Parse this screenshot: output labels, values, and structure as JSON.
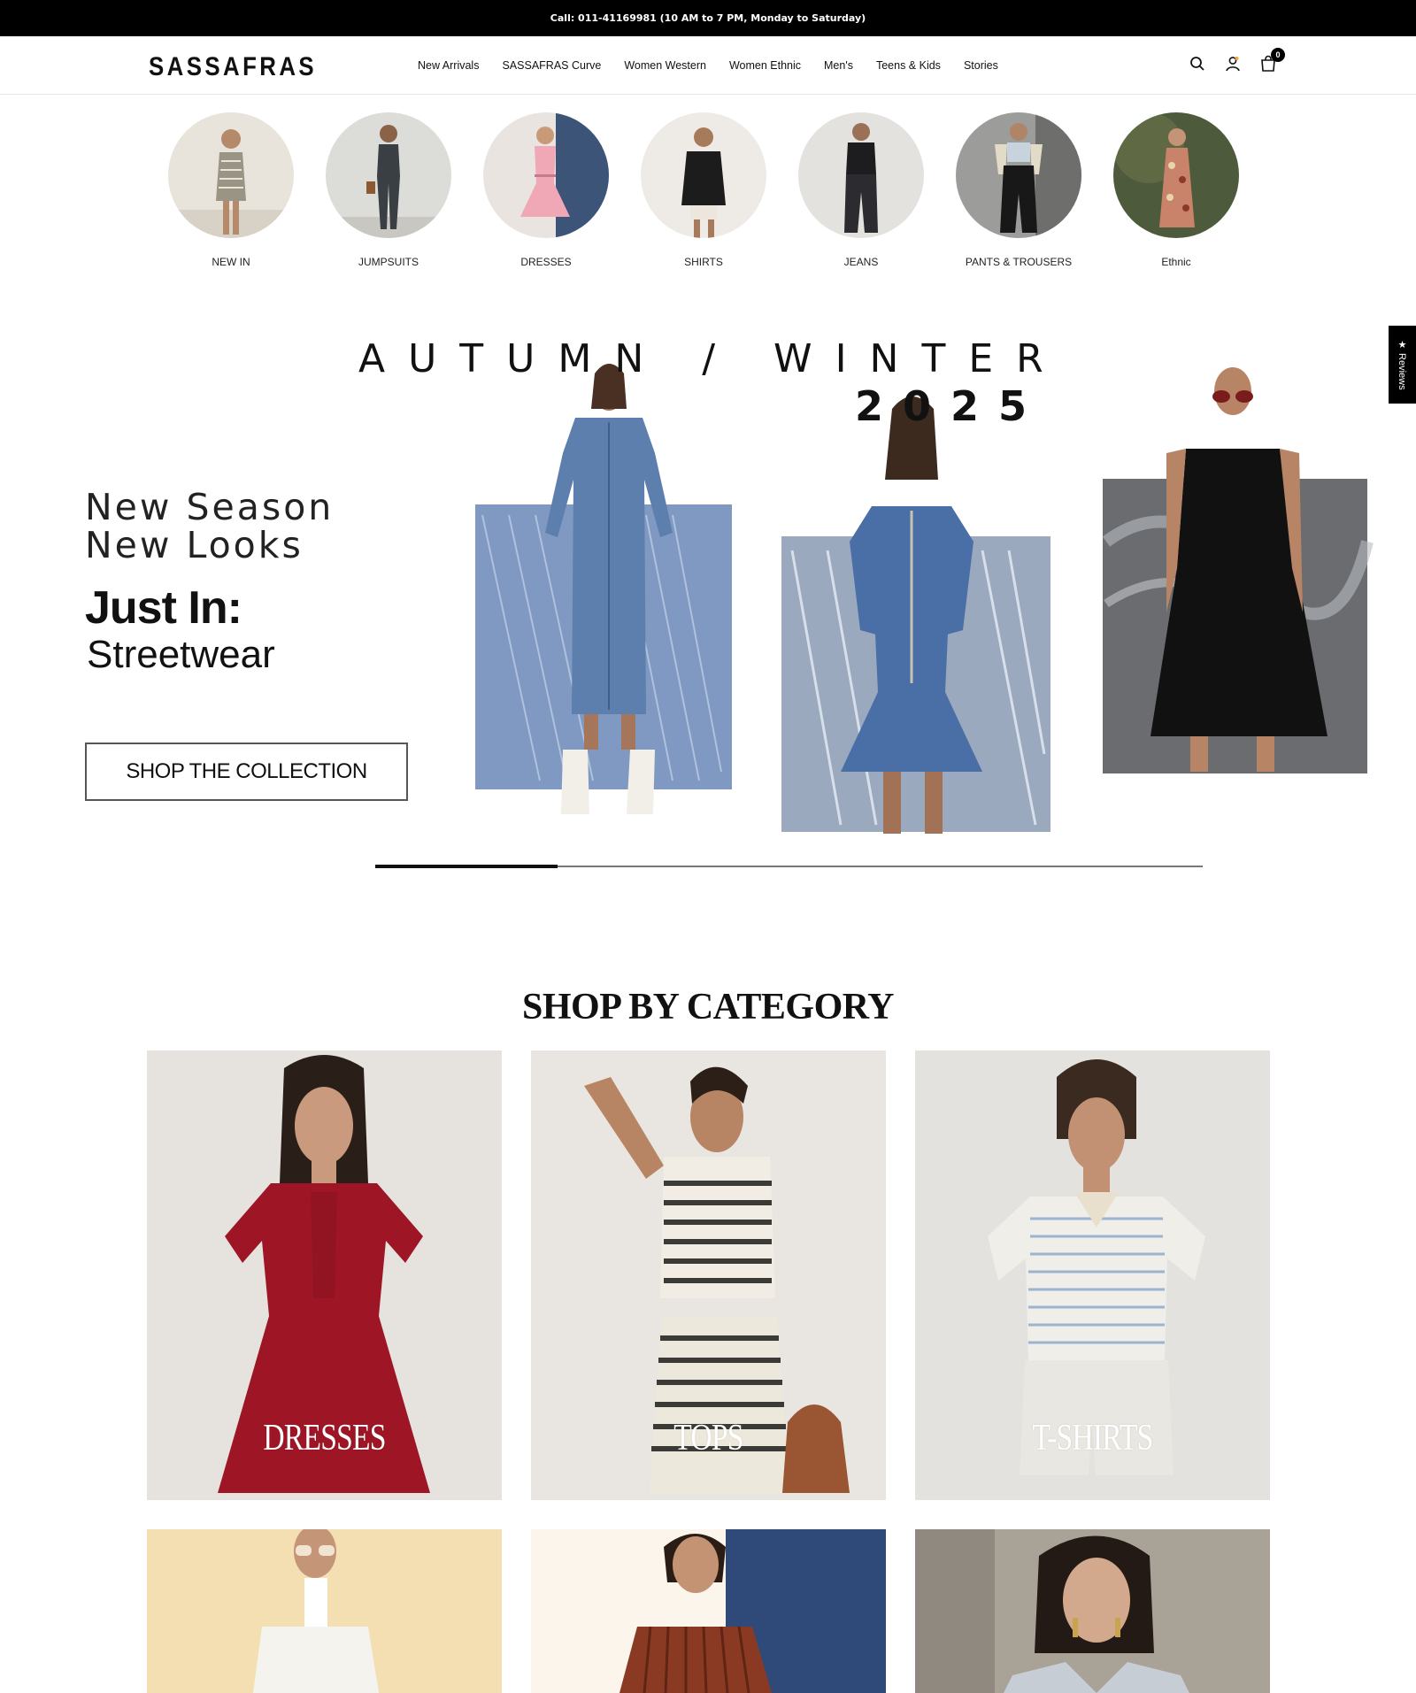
{
  "announcement": "Call: 011-41169981 (10 AM to 7 PM, Monday to Saturday)",
  "header": {
    "logo": "SASSAFRAS",
    "nav": [
      "New Arrivals",
      "SASSAFRAS Curve",
      "Women Western",
      "Women Ethnic",
      "Men's",
      "Teens & Kids",
      "Stories"
    ],
    "icons": [
      "search-icon",
      "account-icon",
      "cart-icon"
    ],
    "cart_count": "0"
  },
  "categories": [
    {
      "label": "NEW IN",
      "bg": "#e8e4dc",
      "outfit": "#9a9484"
    },
    {
      "label": "JUMPSUITS",
      "bg": "#dcdcd8",
      "outfit": "#3a3f44"
    },
    {
      "label": "DRESSES",
      "bg": "#e9e4df",
      "outfit": "#f0a7b6"
    },
    {
      "label": "SHIRTS",
      "bg": "#eeebe7",
      "outfit": "#1c1c1c"
    },
    {
      "label": "JEANS",
      "bg": "#e4e2de",
      "outfit": "#232326"
    },
    {
      "label": "PANTS & TROUSERS",
      "bg": "#9c9c9a",
      "outfit": "#181818"
    },
    {
      "label": "Ethnic",
      "bg": "#4e5a3c",
      "outfit": "#c8836a"
    }
  ],
  "hero": {
    "title": "AUTUMN / WINTER",
    "year": "2025",
    "line1": "New Season",
    "line2": "New Looks",
    "just_in": "Just In:",
    "subtitle": "Streetwear",
    "button": "SHOP THE COLLECTION",
    "slider_progress": 0.22
  },
  "reviews_tab": "★ Reviews",
  "shop_by_category": {
    "title": "SHOP BY CATEGORY",
    "cards": [
      {
        "label": "DRESSES",
        "bg": "#e6e3df",
        "outfit": "#9e1626"
      },
      {
        "label": "TOPS",
        "bg": "#e9e6e1",
        "outfit": "#3b3a36"
      },
      {
        "label": "T-SHIRTS",
        "bg": "#e4e2de",
        "outfit": "#e9e7e1"
      },
      {
        "label": "",
        "bg": "#f3dfb2",
        "outfit": "#f5f3ee"
      },
      {
        "label": "",
        "bg": "#fbf5ec",
        "outfit": "#8a3a22"
      },
      {
        "label": "",
        "bg": "#a8a297",
        "outfit": "#c7cdd4"
      }
    ]
  },
  "colors": {
    "topbar": "#000000",
    "text": "#111111",
    "denim": "#5c7fae"
  }
}
